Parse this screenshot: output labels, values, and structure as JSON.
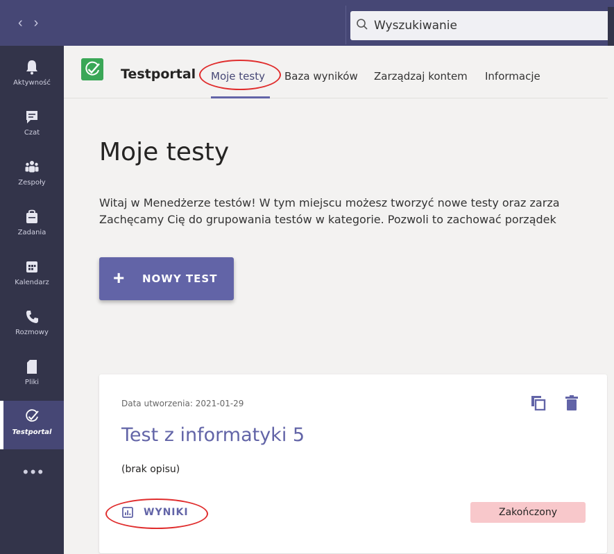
{
  "search": {
    "placeholder": "Wyszukiwanie"
  },
  "rail": {
    "items": [
      {
        "label": "Aktywność",
        "icon": "bell-icon"
      },
      {
        "label": "Czat",
        "icon": "chat-icon"
      },
      {
        "label": "Zespoły",
        "icon": "teams-icon"
      },
      {
        "label": "Zadania",
        "icon": "assignments-icon"
      },
      {
        "label": "Kalendarz",
        "icon": "calendar-icon"
      },
      {
        "label": "Rozmowy",
        "icon": "phone-icon"
      },
      {
        "label": "Pliki",
        "icon": "file-icon"
      },
      {
        "label": "Testportal",
        "icon": "testportal-icon",
        "active": true
      }
    ],
    "more": "•••"
  },
  "app": {
    "name": "Testportal",
    "tabs": [
      {
        "label": "Moje testy",
        "active": true
      },
      {
        "label": "Baza wyników"
      },
      {
        "label": "Zarządzaj kontem"
      },
      {
        "label": "Informacje"
      }
    ]
  },
  "main": {
    "title": "Moje testy",
    "intro_line1": "Witaj w Menedżerze testów! W tym miejscu możesz tworzyć nowe testy oraz zarza",
    "intro_line2": "Zachęcamy Cię do grupowania testów w kategorie. Pozwoli to zachować porządek",
    "new_test_label": "NOWY TEST"
  },
  "test_card": {
    "created": "Data utworzenia: 2021-01-29",
    "title": "Test z informatyki 5",
    "description": "(brak opisu)",
    "results_label": "WYNIKI",
    "status": "Zakończony"
  },
  "colors": {
    "accent": "#6264a7",
    "topbar": "#464775",
    "rail": "#33344a",
    "status_bg": "#f8c8cb",
    "logo_green": "#3aa757",
    "highlight_oval": "#e02d2d"
  }
}
